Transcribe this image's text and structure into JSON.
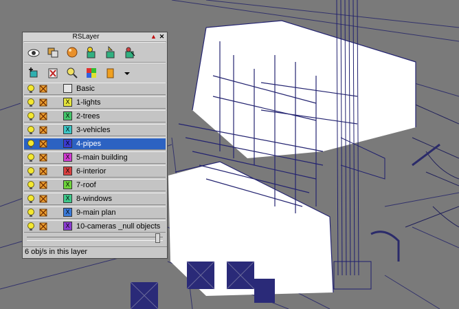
{
  "window": {
    "title": "RSLayer"
  },
  "toolbar_top": [
    {
      "icon": "eye-icon"
    },
    {
      "icon": "layer-stack-icon"
    },
    {
      "icon": "sphere-icon"
    },
    {
      "icon": "new-layer-icon"
    },
    {
      "icon": "add-to-layer-icon"
    },
    {
      "icon": "select-layer-icon"
    }
  ],
  "toolbar_second": [
    {
      "icon": "add-object-icon"
    },
    {
      "icon": "delete-layer-icon"
    },
    {
      "icon": "find-icon"
    },
    {
      "icon": "color-palette-icon"
    },
    {
      "icon": "layer-options-icon"
    },
    {
      "icon": "dropdown-arrow-icon"
    }
  ],
  "layers": [
    {
      "name": "Basic",
      "mark": "",
      "color": "#e6e6e6",
      "selected": false
    },
    {
      "name": "1-lights",
      "mark": "X",
      "color": "#e4e43c",
      "selected": false
    },
    {
      "name": "2-trees",
      "mark": "X",
      "color": "#44c46a",
      "selected": false
    },
    {
      "name": "3-vehicles",
      "mark": "X",
      "color": "#3cc6c6",
      "selected": false
    },
    {
      "name": "4-pipes",
      "mark": "X",
      "color": "#3a3ad0",
      "selected": true
    },
    {
      "name": "5-main building",
      "mark": "X",
      "color": "#d03cd0",
      "selected": false
    },
    {
      "name": "6-interior",
      "mark": "X",
      "color": "#d84040",
      "selected": false
    },
    {
      "name": "7-roof",
      "mark": "X",
      "color": "#6ed43c",
      "selected": false
    },
    {
      "name": "8-windows",
      "mark": "X",
      "color": "#3ec88a",
      "selected": false
    },
    {
      "name": "9-main plan",
      "mark": "X",
      "color": "#3a7ad8",
      "selected": false
    },
    {
      "name": "10-cameras _null objects",
      "mark": "X",
      "color": "#8a3cd0",
      "selected": false
    }
  ],
  "status": {
    "text": "6 obj/s in this layer"
  },
  "slider": {
    "position": 0.98
  }
}
